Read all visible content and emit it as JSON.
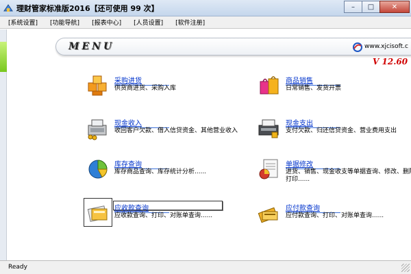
{
  "window": {
    "title": "理财管家标准版2016【还可使用 99 次】",
    "minimize_glyph": "–",
    "maximize_glyph": "□",
    "close_glyph": "✕"
  },
  "menubar": [
    {
      "label": "[系统设置]"
    },
    {
      "label": "[功能导航]"
    },
    {
      "label": "[报表中心]"
    },
    {
      "label": "[人员设置]"
    },
    {
      "label": "[软件注册]"
    }
  ],
  "header": {
    "menu_logo": "MENU",
    "site": "www.xjcisoft.c",
    "version": "V 12.60"
  },
  "modules": [
    {
      "title": "采购进货",
      "desc": "供货商进货、采购入库",
      "icon": "purchase-boxes-icon"
    },
    {
      "title": "商品销售",
      "desc": "日常销售、发货开票",
      "icon": "shopping-bags-icon"
    },
    {
      "title": "现金收入",
      "desc": "收回客户欠款、借入信贷资金、其他营业收入",
      "icon": "cash-register-icon"
    },
    {
      "title": "现金支出",
      "desc": "支付欠款、归还信贷资金、营业费用支出",
      "icon": "cash-printer-icon"
    },
    {
      "title": "库存查询",
      "desc": "库存商品查询、库存统计分析......",
      "icon": "pie-chart-icon"
    },
    {
      "title": "单据修改",
      "desc": "进货、销售、现金收支等单据查询、修改、删除、打印......",
      "icon": "document-chart-icon"
    },
    {
      "title": "应收款查询",
      "desc": "应收款查询、打印、对账单查询......",
      "icon": "receivable-folder-icon"
    },
    {
      "title": "应付款查询",
      "desc": "应付款查询、打印、对账单查询......",
      "icon": "payable-card-icon"
    }
  ],
  "status": {
    "text": "Ready"
  },
  "colors": {
    "link": "#0033cc",
    "version": "#d00000",
    "accent_green": "#78c81e"
  }
}
